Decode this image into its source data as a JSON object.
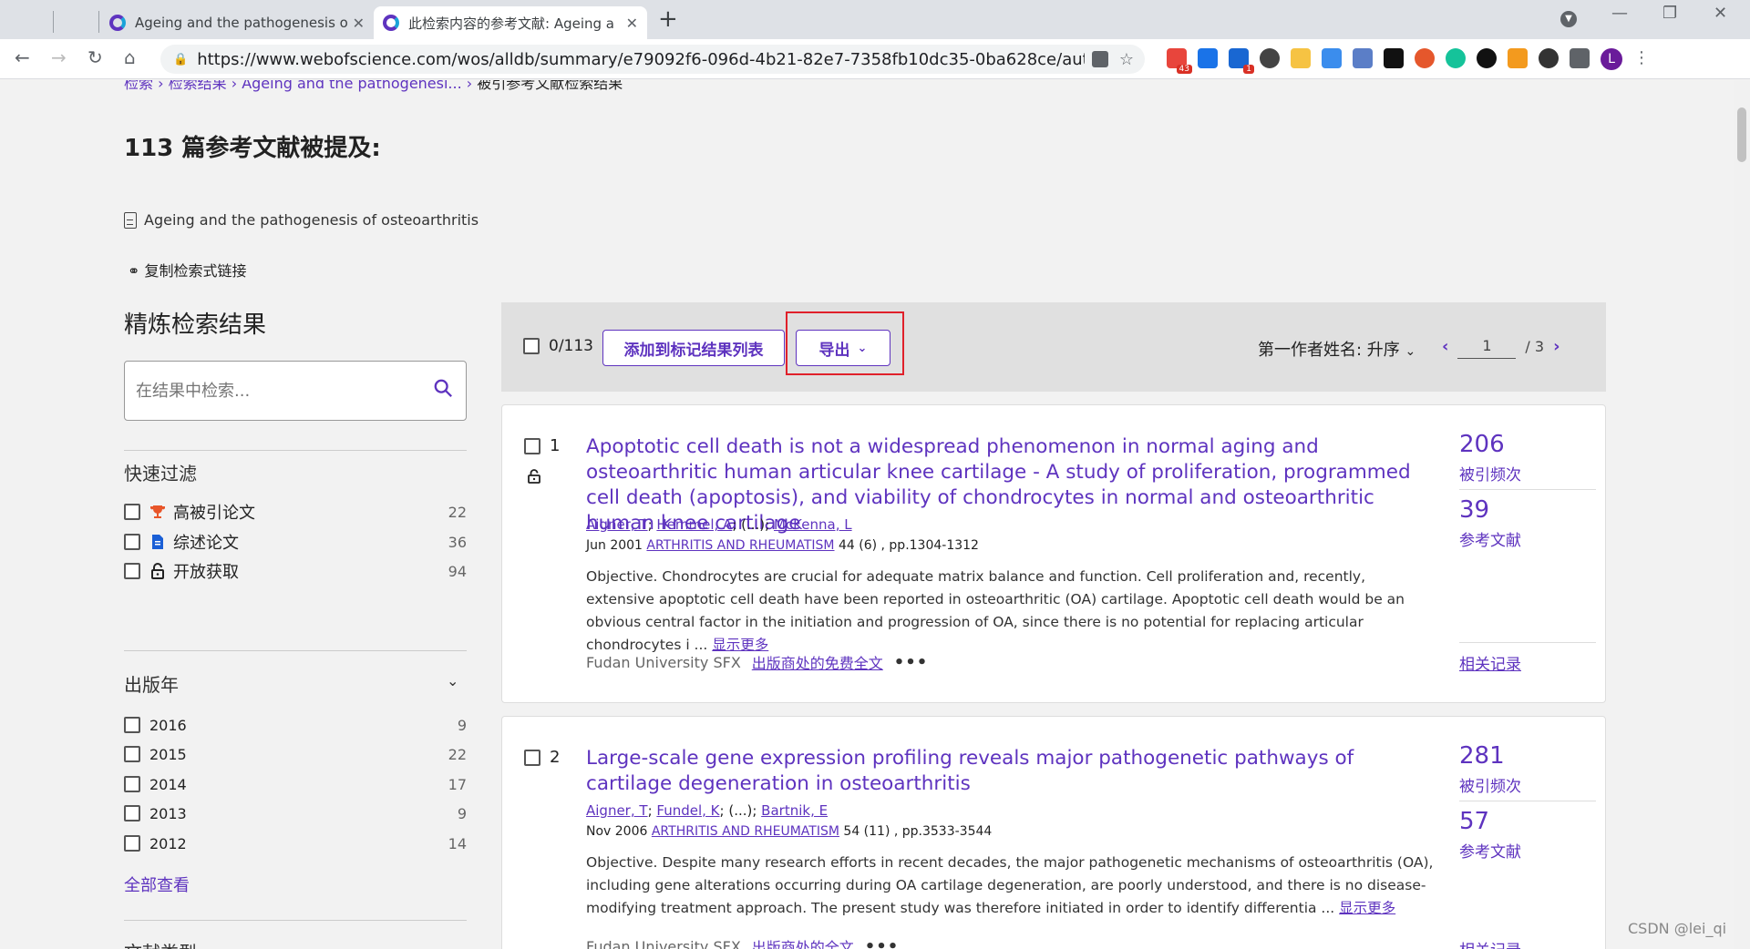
{
  "browser": {
    "tabs": [
      {
        "title": "Ageing and the pathogenesis o",
        "active": false
      },
      {
        "title": "此检索内容的参考文献: Ageing a",
        "active": true
      }
    ],
    "url": "https://www.webofscience.com/wos/alldb/summary/e79092f6-096d-4b21-82e7-7358fb10dc35-0ba628ce/author...",
    "ext_badges": {
      "ext1": "43",
      "ext2": "1"
    },
    "profile_initial": "L"
  },
  "breadcrumb": {
    "items": [
      "检索",
      "检索结果",
      "Ageing and the pathogenesi..."
    ],
    "current": "被引参考文献检索结果"
  },
  "heading": "113 篇参考文献被提及:",
  "query_title": "Ageing and the pathogenesis of osteoarthritis",
  "copy_link_label": "复制检索式链接",
  "refine": {
    "title": "精炼检索结果",
    "search_placeholder": "在结果中检索...",
    "quick_filter_title": "快速过滤",
    "quick_filters": [
      {
        "label": "高被引论文",
        "count": "22",
        "icon": "trophy-icon"
      },
      {
        "label": "综述论文",
        "count": "36",
        "icon": "document-icon"
      },
      {
        "label": "开放获取",
        "count": "94",
        "icon": "lock-icon"
      }
    ],
    "pub_year_title": "出版年",
    "years": [
      {
        "label": "2016",
        "count": "9"
      },
      {
        "label": "2015",
        "count": "22"
      },
      {
        "label": "2014",
        "count": "17"
      },
      {
        "label": "2013",
        "count": "9"
      },
      {
        "label": "2012",
        "count": "14"
      }
    ],
    "see_all": "全部查看",
    "doc_type_title": "文献类型"
  },
  "toolbar": {
    "select_count": "0/113",
    "add_to_marked": "添加到标记结果列表",
    "export": "导出",
    "sort": "第一作者姓名: 升序",
    "page": "1",
    "page_total": "/ 3"
  },
  "results": [
    {
      "index": "1",
      "title": "Apoptotic cell death is not a widespread phenomenon in normal aging and osteoarthritic human articular knee cartilage - A study of proliferation, programmed cell death (apoptosis), and viability of chondrocytes in normal and osteoarthritic human knee cartilage",
      "authors": [
        "Aigner, T",
        "Hemmel, A",
        "McKenna, L"
      ],
      "authors_sep": "; (...); ",
      "date": "Jun 2001",
      "journal": "ARTHRITIS AND RHEUMATISM",
      "volume": "44 (6) , pp.1304-1312",
      "abstract": "Objective. Chondrocytes are crucial for adequate matrix balance and function. Cell proliferation and, recently, extensive apoptotic cell death have been reported in osteoarthritic (OA) cartilage. Apoptotic cell death would be an obvious central factor in the initiation and progression of OA, since there is no potential for replacing articular chondrocytes i",
      "show_more": "显示更多",
      "sfx": "Fudan University SFX",
      "fulltext": "出版商处的免费全文",
      "citations": "206",
      "citations_label": "被引频次",
      "refs": "39",
      "refs_label": "参考文献",
      "related": "相关记录"
    },
    {
      "index": "2",
      "title": "Large-scale gene expression profiling reveals major pathogenetic pathways of cartilage degeneration in osteoarthritis",
      "authors": [
        "Aigner, T",
        "Fundel, K",
        "Bartnik, E"
      ],
      "authors_sep": "; (...); ",
      "date": "Nov 2006",
      "journal": "ARTHRITIS AND RHEUMATISM",
      "volume": "54 (11) , pp.3533-3544",
      "abstract": "Objective. Despite many research efforts in recent decades, the major pathogenetic mechanisms of osteoarthritis (OA), including gene alterations occurring during OA cartilage degeneration, are poorly understood, and there is no disease-modifying treatment approach. The present study was therefore initiated in order to identify differentia",
      "show_more": "显示更多",
      "sfx": "Fudan University SFX",
      "fulltext": "出版商处的全文",
      "citations": "281",
      "citations_label": "被引频次",
      "refs": "57",
      "refs_label": "参考文献",
      "related": "相关记录"
    }
  ],
  "watermark": "CSDN @lei_qi",
  "colors": {
    "accent": "#5e33bf",
    "highlight": "#e0202a"
  }
}
